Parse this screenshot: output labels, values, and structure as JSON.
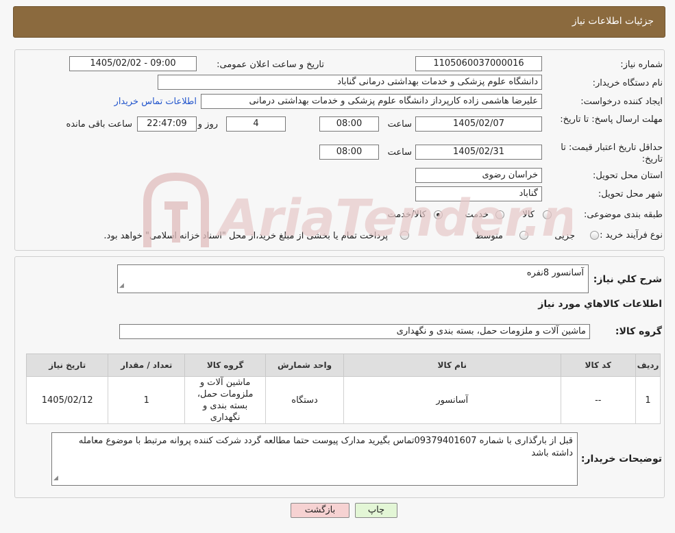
{
  "header": {
    "title": "جزئیات اطلاعات نیاز"
  },
  "form": {
    "need_number_label": "شماره نیاز:",
    "need_number": "1105060037000016",
    "announce_label": "تاریخ و ساعت اعلان عمومی:",
    "announce_value": "1405/02/02 - 09:00",
    "buyer_org_label": "نام دستگاه خریدار:",
    "buyer_org": "دانشگاه علوم پزشکی و خدمات بهداشتی درمانی گناباد",
    "creator_label": "ایجاد کننده درخواست:",
    "creator": "علیرضا هاشمی زاده کارپرداز دانشگاه علوم پزشکی و خدمات بهداشتی درمانی",
    "contact_link": "اطلاعات تماس خریدار",
    "deadline_label": "مهلت ارسال پاسخ: تا تاریخ:",
    "deadline_date": "1405/02/07",
    "time_label": "ساعت",
    "deadline_time": "08:00",
    "days": "4",
    "days_label": "روز و",
    "remaining": "22:47:09",
    "remaining_label": "ساعت باقی مانده",
    "validity_label": "حداقل تاریخ اعتبار قیمت: تا تاریخ:",
    "validity_date": "1405/02/31",
    "validity_time": "08:00",
    "province_label": "استان محل تحویل:",
    "province": "خراسان رضوی",
    "city_label": "شهر محل تحویل:",
    "city": "گناباد",
    "category_label": "طبقه بندی موضوعی:",
    "category_options": [
      "کالا",
      "خدمت",
      "کالا/خدمت"
    ],
    "category_selected": "کالا/خدمت",
    "process_label": "نوع فرآیند خرید :",
    "process_options": [
      "جزیی",
      "متوسط"
    ],
    "payment_note": "پرداخت تمام یا بخشی از مبلغ خرید،از محل \"اسناد خزانه اسلامی\" خواهد بود."
  },
  "description": {
    "label": "شرح کلي نياز:",
    "value": "آسانسور 8نفره",
    "goods_heading": "اطلاعات کالاهاي مورد نياز",
    "group_label": "گروه کالا:",
    "group_value": "ماشین آلات و ملزومات حمل، بسته بندی و نگهداری"
  },
  "table": {
    "headers": [
      "رديف",
      "کد کالا",
      "نام کالا",
      "واحد شمارش",
      "گروه کالا",
      "تعداد / مقدار",
      "تاریخ نیاز"
    ],
    "rows": [
      [
        "1",
        "--",
        "آسانسور",
        "دستگاه",
        "ماشین آلات و ملزومات حمل، بسته بندی و نگهداری",
        "1",
        "1405/02/12"
      ]
    ]
  },
  "buyer_notes": {
    "label": "توضیحات خریدار:",
    "value": "قبل از بارگذاری با شماره 09379401607تماس بگیرید مدارک پیوست حتما مطالعه گردد شرکت کننده پروانه مرتبط با موضوع معامله داشته باشد"
  },
  "buttons": {
    "print": "چاپ",
    "back": "بازگشت"
  },
  "colors": {
    "header": "#8b6a3e",
    "link": "#2255cc",
    "back_button": "#f6d2d2",
    "print_button": "#e3f6d6"
  },
  "watermark": {
    "text": "AriaTender.neT"
  }
}
